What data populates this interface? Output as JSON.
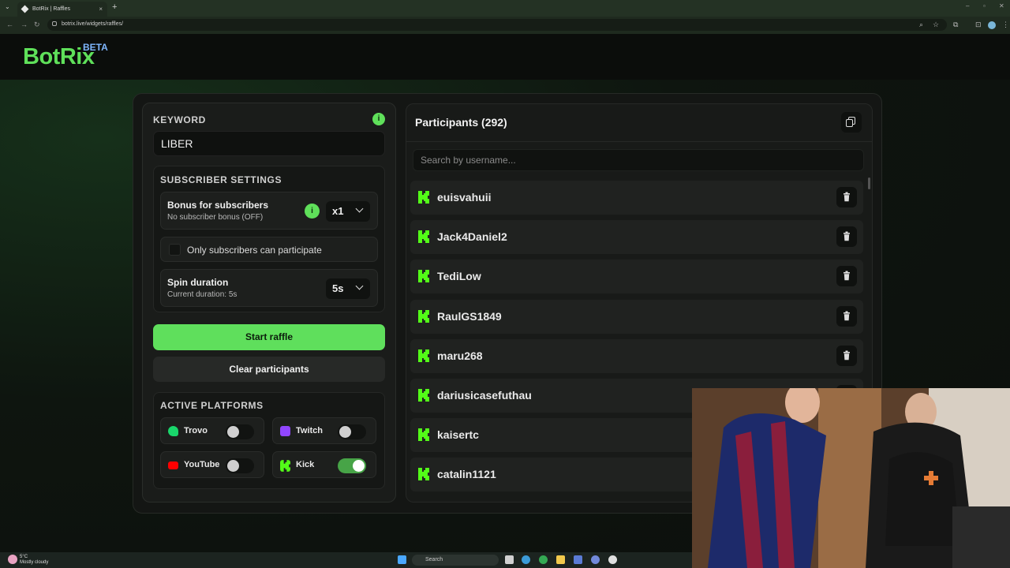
{
  "browser": {
    "tab_title": "BotRix | Raffles",
    "tab_close": "×",
    "new_tab": "+",
    "url": "botrix.live/widgets/raffles/"
  },
  "app": {
    "logo": "BotRix",
    "beta_badge": "BETA",
    "accent_color": "#5fe05a"
  },
  "left": {
    "keyword_label": "KEYWORD",
    "keyword_value": "LIBER",
    "info_icon": "i",
    "subscriber_settings_label": "SUBSCRIBER SETTINGS",
    "bonus": {
      "title": "Bonus for subscribers",
      "subtitle": "No subscriber bonus (OFF)",
      "selected": "x1"
    },
    "only_subs_label": "Only subscribers can participate",
    "spin": {
      "title": "Spin duration",
      "subtitle": "Current duration: 5s",
      "selected": "5s"
    },
    "start_button": "Start raffle",
    "clear_button": "Clear participants",
    "active_platforms_label": "ACTIVE PLATFORMS",
    "platforms": [
      {
        "name": "Trovo",
        "icon": "trovo-icon",
        "color": "#19d66b",
        "enabled": false
      },
      {
        "name": "Twitch",
        "icon": "twitch-icon",
        "color": "#9146ff",
        "enabled": false
      },
      {
        "name": "YouTube",
        "icon": "youtube-icon",
        "color": "#ff0000",
        "enabled": false
      },
      {
        "name": "Kick",
        "icon": "kick-icon",
        "color": "#53fc18",
        "enabled": true
      }
    ]
  },
  "participants": {
    "title": "Participants (292)",
    "search_placeholder": "Search by username...",
    "items": [
      {
        "name": "euisvahuii",
        "platform": "kick"
      },
      {
        "name": "Jack4Daniel2",
        "platform": "kick"
      },
      {
        "name": "TediLow",
        "platform": "kick"
      },
      {
        "name": "RaulGS1849",
        "platform": "kick"
      },
      {
        "name": "maru268",
        "platform": "kick"
      },
      {
        "name": "dariusicasefuthau",
        "platform": "kick"
      },
      {
        "name": "kaisertc",
        "platform": "kick"
      },
      {
        "name": "catalin1121",
        "platform": "kick"
      }
    ]
  },
  "taskbar": {
    "weather_temp": "5°C",
    "weather_desc": "Mostly cloudy",
    "search_label": "Search"
  }
}
